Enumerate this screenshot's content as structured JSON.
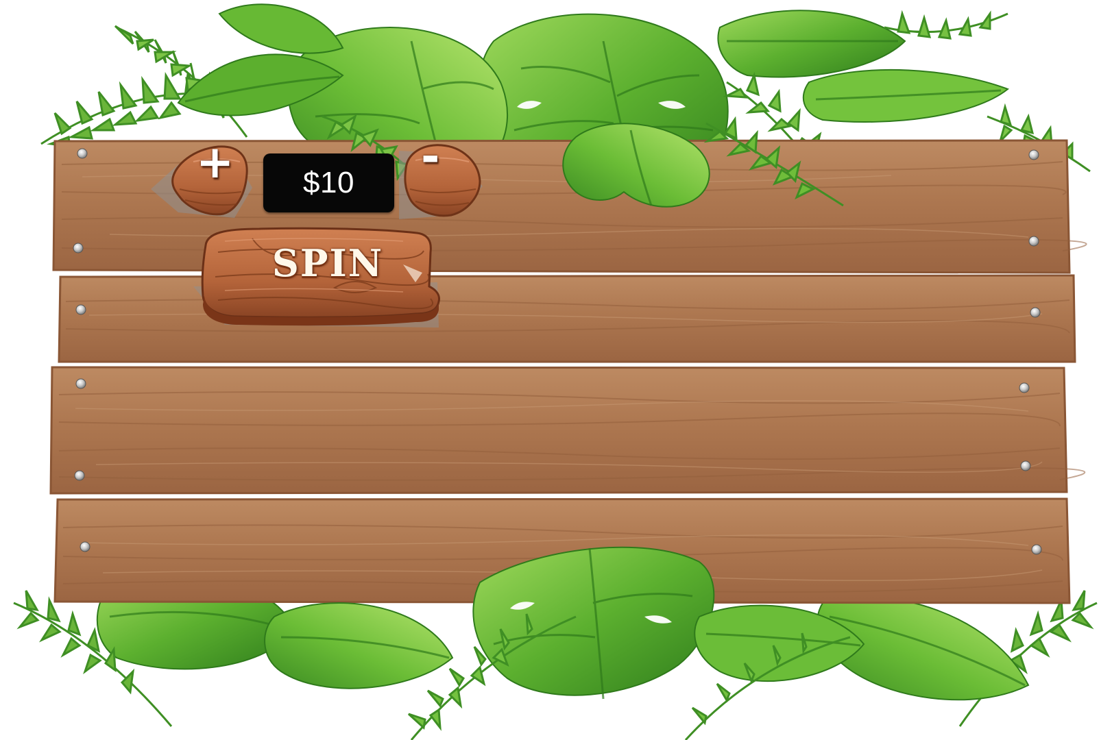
{
  "bet": {
    "amount": "$10"
  },
  "controls": {
    "increase_label": "+",
    "decrease_label": "-",
    "spin_label": "SPIN"
  },
  "colors": {
    "plank_wood": "#b07a52",
    "plank_edge": "#8a5635",
    "button_wood": "#b8673c",
    "leaf_green": "#5fae2e",
    "bet_box_bg": "#070707"
  },
  "icons": {
    "increase": "plus-icon",
    "decrease": "minus-icon"
  }
}
